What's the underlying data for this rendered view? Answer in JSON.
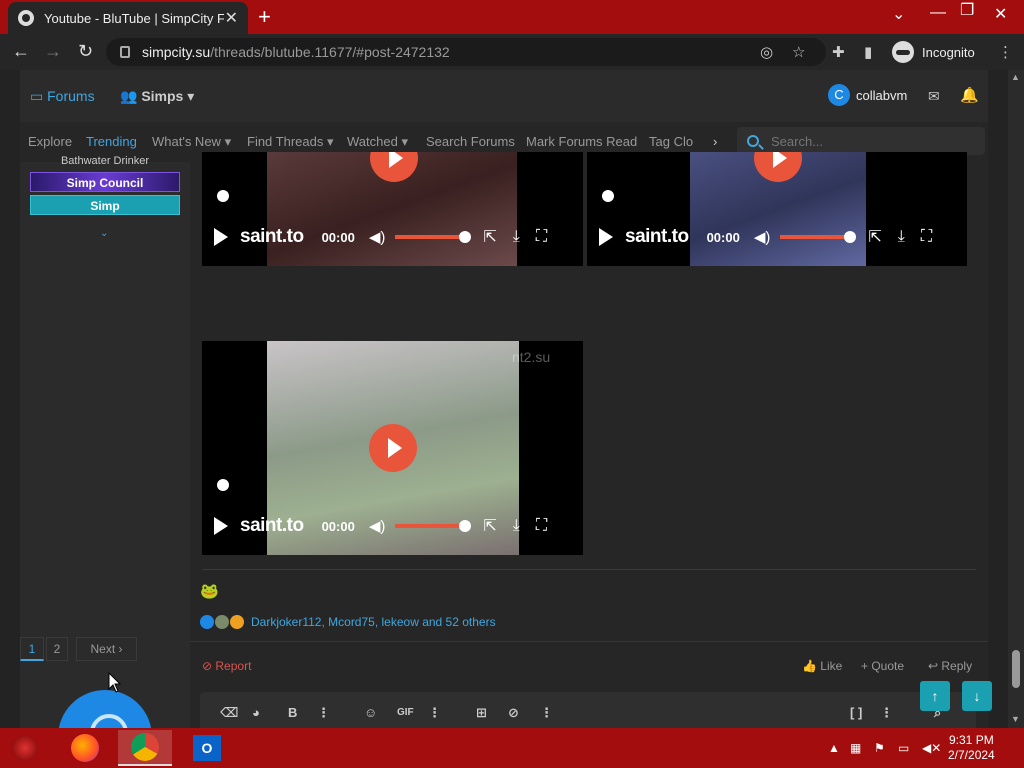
{
  "browser": {
    "tab_title": "Youtube - BluTube | SimpCity Forums",
    "new_tab": "+",
    "url_host": "simpcity.su",
    "url_path": "/threads/blutube.11677/#post-2472132",
    "profile_label": "Incognito",
    "icons": [
      "back-icon",
      "forward-icon",
      "reload-icon",
      "lock-icon",
      "eye-off-icon",
      "star-icon",
      "extensions-icon",
      "sidepanel-icon",
      "menu-icon"
    ]
  },
  "site": {
    "nav_forums": "Forums",
    "nav_simps": "Simps",
    "username": "collabvm",
    "user_initial": "C",
    "subnav": [
      "Explore",
      "Trending",
      "What's New",
      "Find Threads",
      "Watched",
      "Search Forums",
      "Mark Forums Read",
      "Tag Clo"
    ],
    "subnav_active": "Trending",
    "search_placeholder": "Search..."
  },
  "post": {
    "badge_top": "Bathwater Drinker",
    "badge_council": "Simp Council",
    "badge_simp": "Simp",
    "watermark": "nt2.su",
    "video_player": {
      "logo": "saint.to",
      "time": "00:00"
    },
    "reactions_text": "Darkjoker112, Mcord75, lekeow and 52 others",
    "report": "Report",
    "like": "Like",
    "quote": "Quote",
    "reply": "Reply"
  },
  "pagination": {
    "pages": [
      "1",
      "2"
    ],
    "current": "1",
    "next": "Next"
  },
  "editor": {
    "bold": "B",
    "gif": "GIF"
  },
  "taskbar": {
    "time": "9:31 PM",
    "date": "2/7/2024"
  },
  "colors": {
    "accent": "#3fa7e0",
    "taskbar": "#a30d0d",
    "player_accent": "#e8553b",
    "report": "#d9534f"
  }
}
